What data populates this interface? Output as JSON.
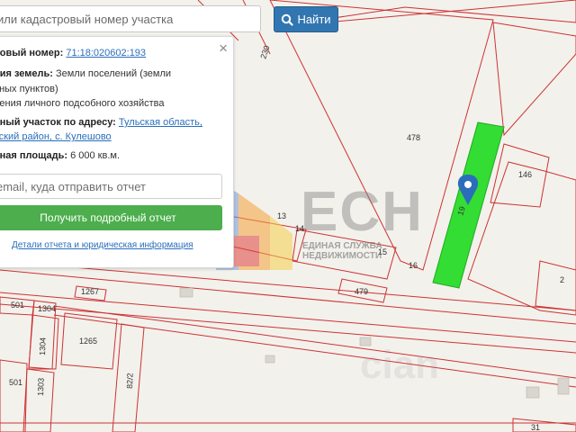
{
  "search": {
    "placeholder": "или кадастровый номер участка",
    "button_label": "Найти"
  },
  "panel": {
    "cadastral_label": "ровый номер:",
    "cadastral_value": "71:18:020602:193",
    "category_label": "рия земель:",
    "category_value_1": "Земли поселений (земли",
    "category_value_2": "нных пунктов)",
    "category_value_3": "дения личного подсобного хозяйства",
    "address_label": "ьный участок по адресу:",
    "address_value_1": "Тульская область,",
    "address_value_2": "вский район, с. Кулешово",
    "area_label": "нная площадь:",
    "area_value": "6 000 кв.м.",
    "email_placeholder": "email, куда отправить отчет",
    "report_button": "Получить подробный отчет",
    "details_link": "Детали отчета и юридическая информация"
  },
  "watermark": {
    "logo_text": "ЕСН",
    "sub_line_1": "ЕДИНАЯ СЛУЖБА",
    "sub_line_2": "НЕДВИЖИМОСТИ",
    "faint_text": "cian"
  },
  "map": {
    "plots": [
      "230",
      "478",
      "19",
      "146",
      "13",
      "14",
      "15",
      "16",
      "479",
      "2",
      "1267",
      "501",
      "1304",
      "1265",
      "1304",
      "501",
      "1303",
      "82/2",
      "31"
    ],
    "colors": {
      "highlight": "#33dd33",
      "boundary": "#cc3333",
      "accent": "#3276b1",
      "marker": "#2a6ebb"
    }
  }
}
